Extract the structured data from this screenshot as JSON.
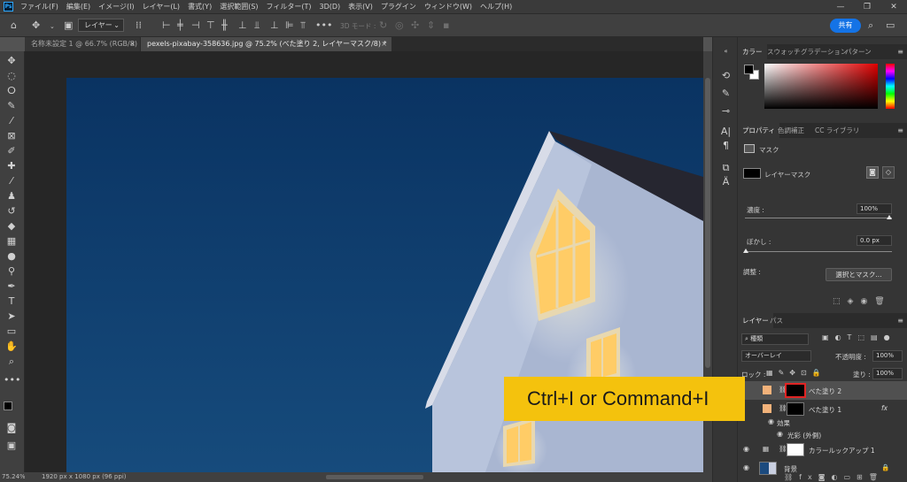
{
  "menubar": {
    "app_icon": "Ps",
    "items": [
      "ファイル(F)",
      "編集(E)",
      "イメージ(I)",
      "レイヤー(L)",
      "書式(Y)",
      "選択範囲(S)",
      "フィルター(T)",
      "3D(D)",
      "表示(V)",
      "プラグイン",
      "ウィンドウ(W)",
      "ヘルプ(H)"
    ],
    "window_controls": [
      "—",
      "❐",
      "✕"
    ]
  },
  "optbar": {
    "layer_select": "レイヤー",
    "mode_3d": "3D モード :",
    "share": "共有"
  },
  "tabs": [
    {
      "label": "名称未設定 1 @ 66.7% (RGB/8)",
      "close": "×"
    },
    {
      "label": "pexels-pixabay-358636.jpg @ 75.2% (べた塗り 2, レイヤーマスク/8) *",
      "close": "×"
    }
  ],
  "status": {
    "zoom": "75.24%",
    "doc_info": "1920 px x 1080 px (96 ppi)"
  },
  "color_panel": {
    "tabs": [
      "カラー",
      "スウォッチ",
      "グラデーション",
      "パターン"
    ]
  },
  "properties": {
    "tabs": [
      "プロパティ",
      "色調補正",
      "CC ライブラリ"
    ],
    "section": "マスク",
    "mask_label": "レイヤーマスク",
    "density_label": "濃度 :",
    "density_value": "100%",
    "feather_label": "ぼかし :",
    "feather_value": "0.0 px",
    "adjust_label": "調整 :",
    "select_mask_button": "選択とマスク..."
  },
  "layers": {
    "tabs": [
      "レイヤー",
      "パス"
    ],
    "filter_kind": "種類",
    "blend_mode": "オーバーレイ",
    "opacity_label": "不透明度 :",
    "opacity_value": "100%",
    "lock_label": "ロック :",
    "fill_label": "塗り :",
    "fill_value": "100%",
    "items": [
      {
        "name": "べた塗り 2"
      },
      {
        "name": "べた塗り 1",
        "fx": "fx"
      },
      {
        "name": "効果"
      },
      {
        "name": "光彩 (外側)"
      },
      {
        "name": "カラールックアップ 1"
      },
      {
        "name": "背景"
      }
    ]
  },
  "callout": {
    "text": "Ctrl+I or Command+I"
  },
  "colors": {
    "accent": "#1473e6",
    "callout_bg": "#f4c20d",
    "highlight_border": "#e02424",
    "sky": "#0f3a67"
  }
}
